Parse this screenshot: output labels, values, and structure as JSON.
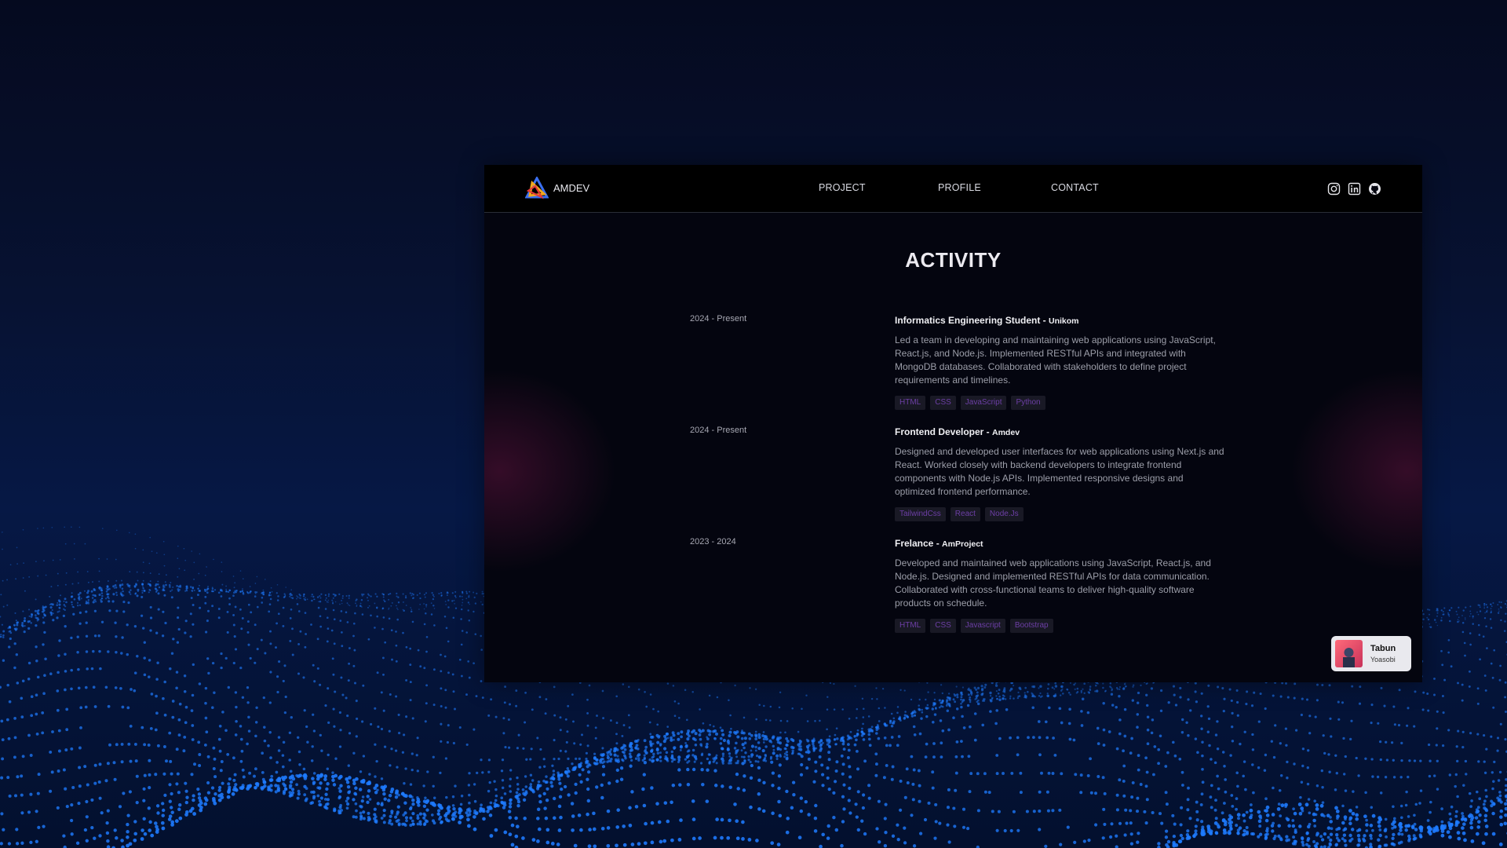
{
  "colors": {
    "page_background": "#061845",
    "window_background": "#04050f",
    "navbar_background": "#000000",
    "accent_tag_text": "#6d3fa6",
    "wave_dots": "#1e7bff"
  },
  "navbar": {
    "brand": "AMDEV",
    "logo_icon": "amdev-logo-icon",
    "links": [
      "PROJECT",
      "PROFILE",
      "CONTACT"
    ],
    "social_icons": [
      "instagram-icon",
      "linkedin-icon",
      "github-icon"
    ]
  },
  "main": {
    "title": "ACTIVITY",
    "entries": [
      {
        "period": "2024 - Present",
        "role": "Informatics Engineering Student - ",
        "company": "Unikom",
        "description": "Led a team in developing and maintaining web applications using JavaScript, React.js, and Node.js. Implemented RESTful APIs and integrated with MongoDB databases. Collaborated with stakeholders to define project requirements and timelines.",
        "tags": [
          "HTML",
          "CSS",
          "JavaScript",
          "Python"
        ]
      },
      {
        "period": "2024 - Present",
        "role": "Frontend Developer - ",
        "company": "Amdev",
        "description": "Designed and developed user interfaces for web applications using Next.js and React. Worked closely with backend developers to integrate frontend components with Node.js APIs. Implemented responsive designs and optimized frontend performance.",
        "tags": [
          "TailwindCss",
          "React",
          "Node.Js"
        ]
      },
      {
        "period": "2023 - 2024",
        "role": "Frelance - ",
        "company": "AmProject",
        "description": "Developed and maintained web applications using JavaScript, React.js, and Node.js. Designed and implemented RESTful APIs for data communication. Collaborated with cross-functional teams to deliver high-quality software products on schedule.",
        "tags": [
          "HTML",
          "CSS",
          "Javascript",
          "Bootstrap"
        ]
      }
    ]
  },
  "music_player": {
    "title": "Tabun",
    "artist": "Yoasobi",
    "album_art_icon": "album-art-icon"
  }
}
